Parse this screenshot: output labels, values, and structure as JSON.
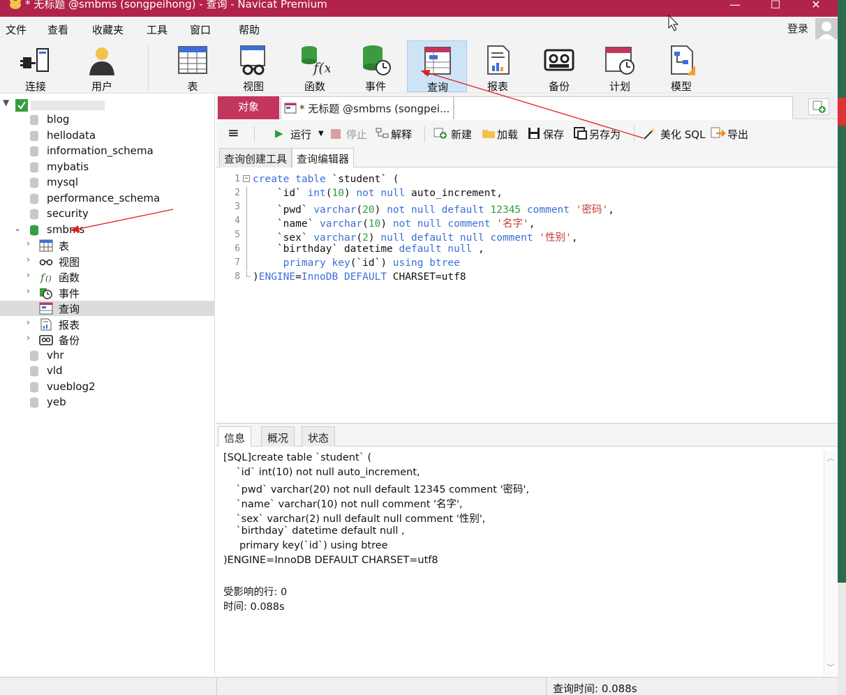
{
  "window": {
    "title": "* 无标题 @smbms (songpeihong) - 查询 - Navicat Premium",
    "controls": {
      "minimize": "—",
      "maximize": "☐",
      "close": "✕"
    }
  },
  "menu": {
    "items": [
      "文件",
      "查看",
      "收藏夹",
      "工具",
      "窗口",
      "帮助"
    ],
    "login": "登录"
  },
  "toolbar": {
    "buttons": [
      {
        "label": "连接",
        "icon": "plug-icon"
      },
      {
        "label": "用户",
        "icon": "user-icon"
      },
      {
        "label": "表",
        "icon": "table-icon"
      },
      {
        "label": "视图",
        "icon": "view-icon"
      },
      {
        "label": "函数",
        "icon": "function-icon"
      },
      {
        "label": "事件",
        "icon": "event-icon"
      },
      {
        "label": "查询",
        "icon": "query-icon",
        "active": true
      },
      {
        "label": "报表",
        "icon": "report-icon"
      },
      {
        "label": "备份",
        "icon": "backup-icon"
      },
      {
        "label": "计划",
        "icon": "schedule-icon"
      },
      {
        "label": "模型",
        "icon": "model-icon"
      }
    ]
  },
  "sidebar": {
    "databases_top": [
      "blog",
      "hellodata",
      "information_schema",
      "mybatis",
      "mysql",
      "performance_schema",
      "security"
    ],
    "open_db": "smbms",
    "open_db_children": [
      "表",
      "视图",
      "函数",
      "事件",
      "查询",
      "报表",
      "备份"
    ],
    "selected_child": "查询",
    "databases_bottom": [
      "vhr",
      "vld",
      "vueblog2",
      "yeb"
    ]
  },
  "tabs": {
    "objects": "对象",
    "query_tab": "* 无标题 @smbms (songpei..."
  },
  "query_toolbar": {
    "menu_icon": "≡",
    "run": "运行",
    "stop": "停止",
    "explain": "解释",
    "new": "新建",
    "load": "加载",
    "save": "保存",
    "save_as": "另存为",
    "beautify": "美化 SQL",
    "export": "导出"
  },
  "editor_tabs": [
    "查询创建工具",
    "查询编辑器"
  ],
  "editor": {
    "line_numbers": [
      "1",
      "2",
      "3",
      "4",
      "5",
      "6",
      "7",
      "8"
    ]
  },
  "result_tabs": [
    "信息",
    "概况",
    "状态"
  ],
  "result": {
    "lines": [
      "[SQL]create table `student` (",
      "    `id` int(10) not null auto_increment,",
      "    `pwd` varchar(20) not null default 12345 comment '密码',",
      "    `name` varchar(10) not null comment '名字',",
      "    `sex` varchar(2) null default null comment '性别',",
      "    `birthday` datetime default null ,",
      "     primary key(`id`) using btree",
      ")ENGINE=InnoDB DEFAULT CHARSET=utf8",
      "",
      "受影响的行: 0",
      "时间: 0.088s"
    ]
  },
  "status": {
    "query_time": "查询时间: 0.088s"
  },
  "colors": {
    "titlebar": "#b1234a",
    "objects_tab": "#c2365e",
    "keyword": "#3b6fd6",
    "number": "#2e9b3c",
    "string": "#c53a3a",
    "annotation_arrow": "#e02020"
  }
}
